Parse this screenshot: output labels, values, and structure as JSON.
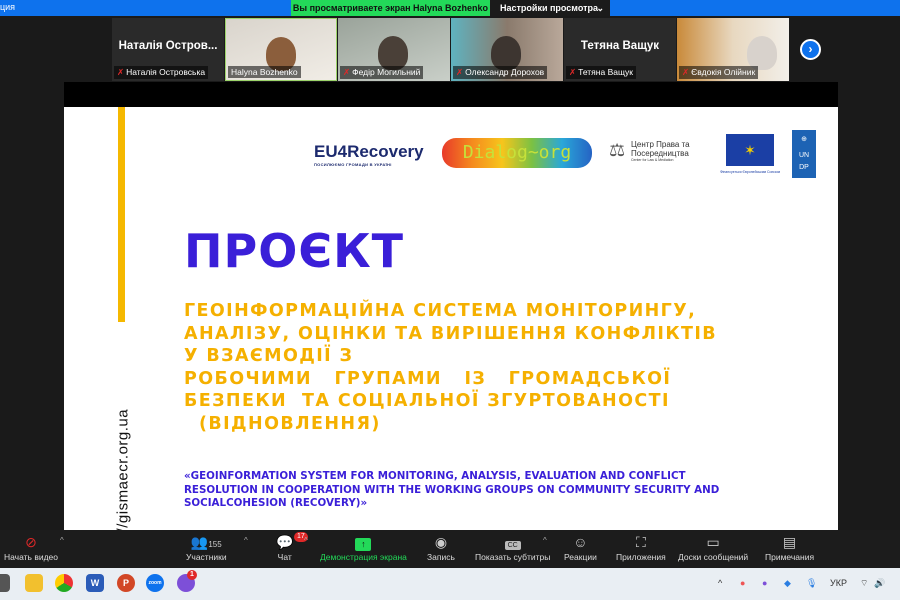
{
  "topbar": {
    "left_text": "ция",
    "viewing": "Вы просматриваете экран Halyna Bozhenko",
    "view_options": "Настройки просмотра"
  },
  "participants": [
    {
      "name": "Наталія Островська",
      "display": "Наталія Остров...",
      "video": false,
      "muted": true
    },
    {
      "name": "Halyna Bozhenko",
      "video": true,
      "muted": false
    },
    {
      "name": "Федір Могильний",
      "video": true,
      "muted": true
    },
    {
      "name": "Олександр Дорохов",
      "video": true,
      "muted": true
    },
    {
      "name": "Тетяна Ващук",
      "display": "Тетяна Ващук",
      "video": false,
      "muted": true
    },
    {
      "name": "Євдокія Олійник",
      "video": true,
      "muted": true
    }
  ],
  "slide": {
    "logos": {
      "eu4recovery": "EU4Recovery",
      "eu4recovery_sub": "ПОСИЛЮЄМО ГРОМАДИ В УКРАЇНІ",
      "dialog": "Dialog~org",
      "clm": "Центр Права та Посередництва",
      "clm_sub": "Center for Law & Mediation",
      "eu_caption": "Фінансується Європейським Союзом",
      "undp": "UNDP"
    },
    "url": "https://gismaecr.org.ua",
    "title": "ПРОЄКТ",
    "uk_lines": [
      "ГЕОІНФОРМАЦІЙНА  СИСТЕМА  МОНІТОРИНГУ,",
      "АНАЛІЗУ, ОЦІНКИ ТА ВИРІШЕННЯ КОНФЛІКТІВ",
      "У ВЗАЄМОДІЇ З",
      "РОБОЧИМИ   ГРУПАМИ   ІЗ   ГРОМАДСЬКОЇ",
      "БЕЗПЕКИ  ТА СОЦІАЛЬНОЇ ЗГУРТОВАНОСТІ",
      "  (ВІДНОВЛЕННЯ)"
    ],
    "en": "«GEOINFORMATION SYSTEM FOR MONITORING, ANALYSIS, EVALUATION AND CONFLICT RESOLUTION IN COOPERATION WITH THE WORKING GROUPS ON COMMUNITY SECURITY AND SOCIALCOHESION (RECOVERY)»"
  },
  "toolbar": {
    "video": "Начать видео",
    "participants": "Участники",
    "participants_count": "155",
    "chat": "Чат",
    "chat_badge": "17",
    "share": "Демонстрация экрана",
    "record": "Запись",
    "captions": "Показать субтитры",
    "cc": "CC",
    "reactions": "Реакции",
    "apps": "Приложения",
    "whiteboards": "Доски сообщений",
    "notes": "Примечания"
  },
  "taskbar": {
    "viber_badge": "1",
    "word": "W",
    "ppt": "P",
    "zoom": "zoom",
    "lang": "УКР"
  }
}
